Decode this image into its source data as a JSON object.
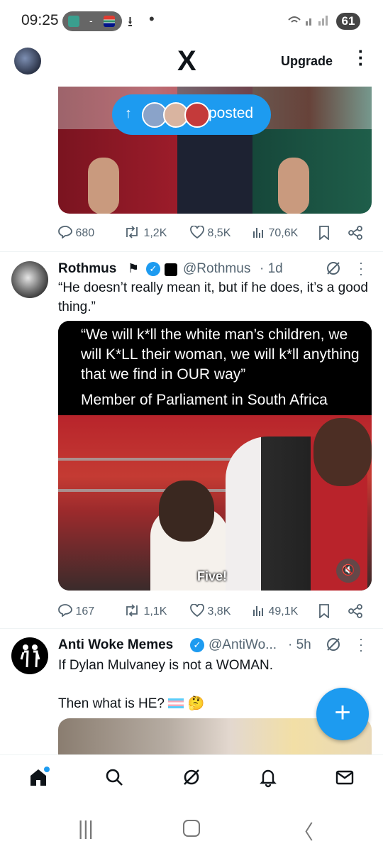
{
  "status_bar": {
    "time": "09:25",
    "battery": "61"
  },
  "header": {
    "logo": "X",
    "upgrade_label": "Upgrade"
  },
  "posted_pill": {
    "label": "posted"
  },
  "tweet1": {
    "stats": {
      "replies": "680",
      "reposts": "1,2K",
      "likes": "8,5K",
      "views": "70,6K"
    }
  },
  "tweet2": {
    "name": "Rothmus",
    "handle": "@Rothmus",
    "time": "· 1d",
    "text": "“He doesn’t really mean it, but if he does, it’s a good thing.”",
    "media": {
      "quote": "“We will k*ll the white man’s children, we will K*LL their woman, we will k*ll anything that we find in OUR way”",
      "attribution": "Member of Parliament in South Africa",
      "caption": "Five!"
    },
    "stats": {
      "replies": "167",
      "reposts": "1,1K",
      "likes": "3,8K",
      "views": "49,1K"
    }
  },
  "tweet3": {
    "name": "Anti Woke Memes",
    "handle": "@AntiWo...",
    "time": "· 5h",
    "text_line1": "If Dylan Mulvaney is not a WOMAN.",
    "text_line2": "Then what is HE?"
  },
  "colors": {
    "accent": "#1d9bf0",
    "text": "#0f1419",
    "muted": "#536471"
  },
  "icons": [
    "home-icon",
    "search-icon",
    "grok-icon",
    "bell-icon",
    "mail-icon",
    "reply-icon",
    "repost-icon",
    "like-icon",
    "views-icon",
    "bookmark-icon",
    "share-icon"
  ]
}
